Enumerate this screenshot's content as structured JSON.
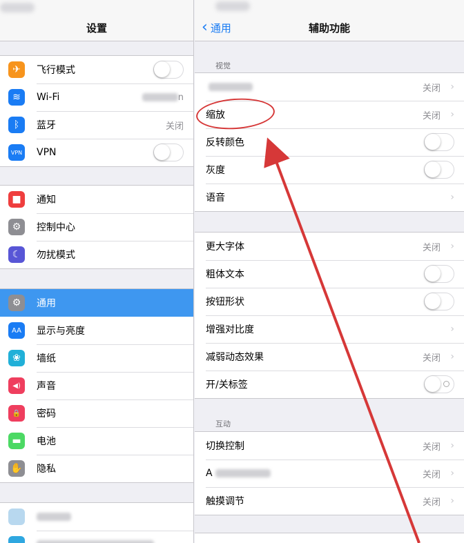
{
  "left": {
    "title": "设置",
    "groups": [
      [
        {
          "label": "飞行模式",
          "icon": "airplane-icon",
          "color": "#f7941d",
          "glyph": "✈",
          "control": "toggle"
        },
        {
          "label": "Wi-Fi",
          "icon": "wifi-icon",
          "color": "#1a7cf4",
          "glyph": "≋",
          "value": "n"
        },
        {
          "label": "蓝牙",
          "icon": "bluetooth-icon",
          "color": "#1a7cf4",
          "glyph": "ᛒ",
          "value": "关闭"
        },
        {
          "label": "VPN",
          "icon": "vpn-icon",
          "color": "#1a7cf4",
          "glyph": "VPN",
          "control": "toggle"
        }
      ],
      [
        {
          "label": "通知",
          "icon": "notifications-icon",
          "color": "#ef3e3e",
          "glyph": "■"
        },
        {
          "label": "控制中心",
          "icon": "control-center-icon",
          "color": "#8e8e93",
          "glyph": "⚙"
        },
        {
          "label": "勿扰模式",
          "icon": "moon-icon",
          "color": "#5856d6",
          "glyph": "☾"
        }
      ],
      [
        {
          "label": "通用",
          "icon": "gear-icon",
          "color": "#8e8e93",
          "glyph": "⚙",
          "selected": true
        },
        {
          "label": "显示与亮度",
          "icon": "display-icon",
          "color": "#1a7cf4",
          "glyph": "AA"
        },
        {
          "label": "墙纸",
          "icon": "wallpaper-icon",
          "color": "#21b0d8",
          "glyph": "❀"
        },
        {
          "label": "声音",
          "icon": "sound-icon",
          "color": "#ef3e5e",
          "glyph": "◀)"
        },
        {
          "label": "密码",
          "icon": "lock-icon",
          "color": "#ef3e5e",
          "glyph": "🔒"
        },
        {
          "label": "电池",
          "icon": "battery-icon",
          "color": "#4cd964",
          "glyph": "▬"
        },
        {
          "label": "隐私",
          "icon": "hand-icon",
          "color": "#8e8e93",
          "glyph": "✋"
        }
      ]
    ]
  },
  "right": {
    "back_label": "通用",
    "title": "辅助功能",
    "sections": [
      {
        "header": "视觉",
        "rows": [
          {
            "label": "",
            "value": "关闭",
            "chevron": true,
            "blurred": true
          },
          {
            "label": "缩放",
            "value": "关闭",
            "chevron": true
          },
          {
            "label": "反转颜色",
            "control": "toggle"
          },
          {
            "label": "灰度",
            "control": "toggle"
          },
          {
            "label": "语音",
            "chevron": true
          }
        ]
      },
      {
        "header": "",
        "rows": [
          {
            "label": "更大字体",
            "value": "关闭",
            "chevron": true
          },
          {
            "label": "粗体文本",
            "control": "toggle"
          },
          {
            "label": "按钮形状",
            "control": "toggle"
          },
          {
            "label": "增强对比度",
            "chevron": true
          },
          {
            "label": "减弱动态效果",
            "value": "关闭",
            "chevron": true
          },
          {
            "label": "开/关标签",
            "control": "toggle-oc"
          }
        ]
      },
      {
        "header": "互动",
        "rows": [
          {
            "label": "切换控制",
            "value": "关闭",
            "chevron": true
          },
          {
            "label": "A",
            "value": "关闭",
            "chevron": true,
            "blurred": true
          },
          {
            "label": "触摸调节",
            "value": "关闭",
            "chevron": true
          }
        ]
      }
    ]
  },
  "annotation_color": "#d63838"
}
